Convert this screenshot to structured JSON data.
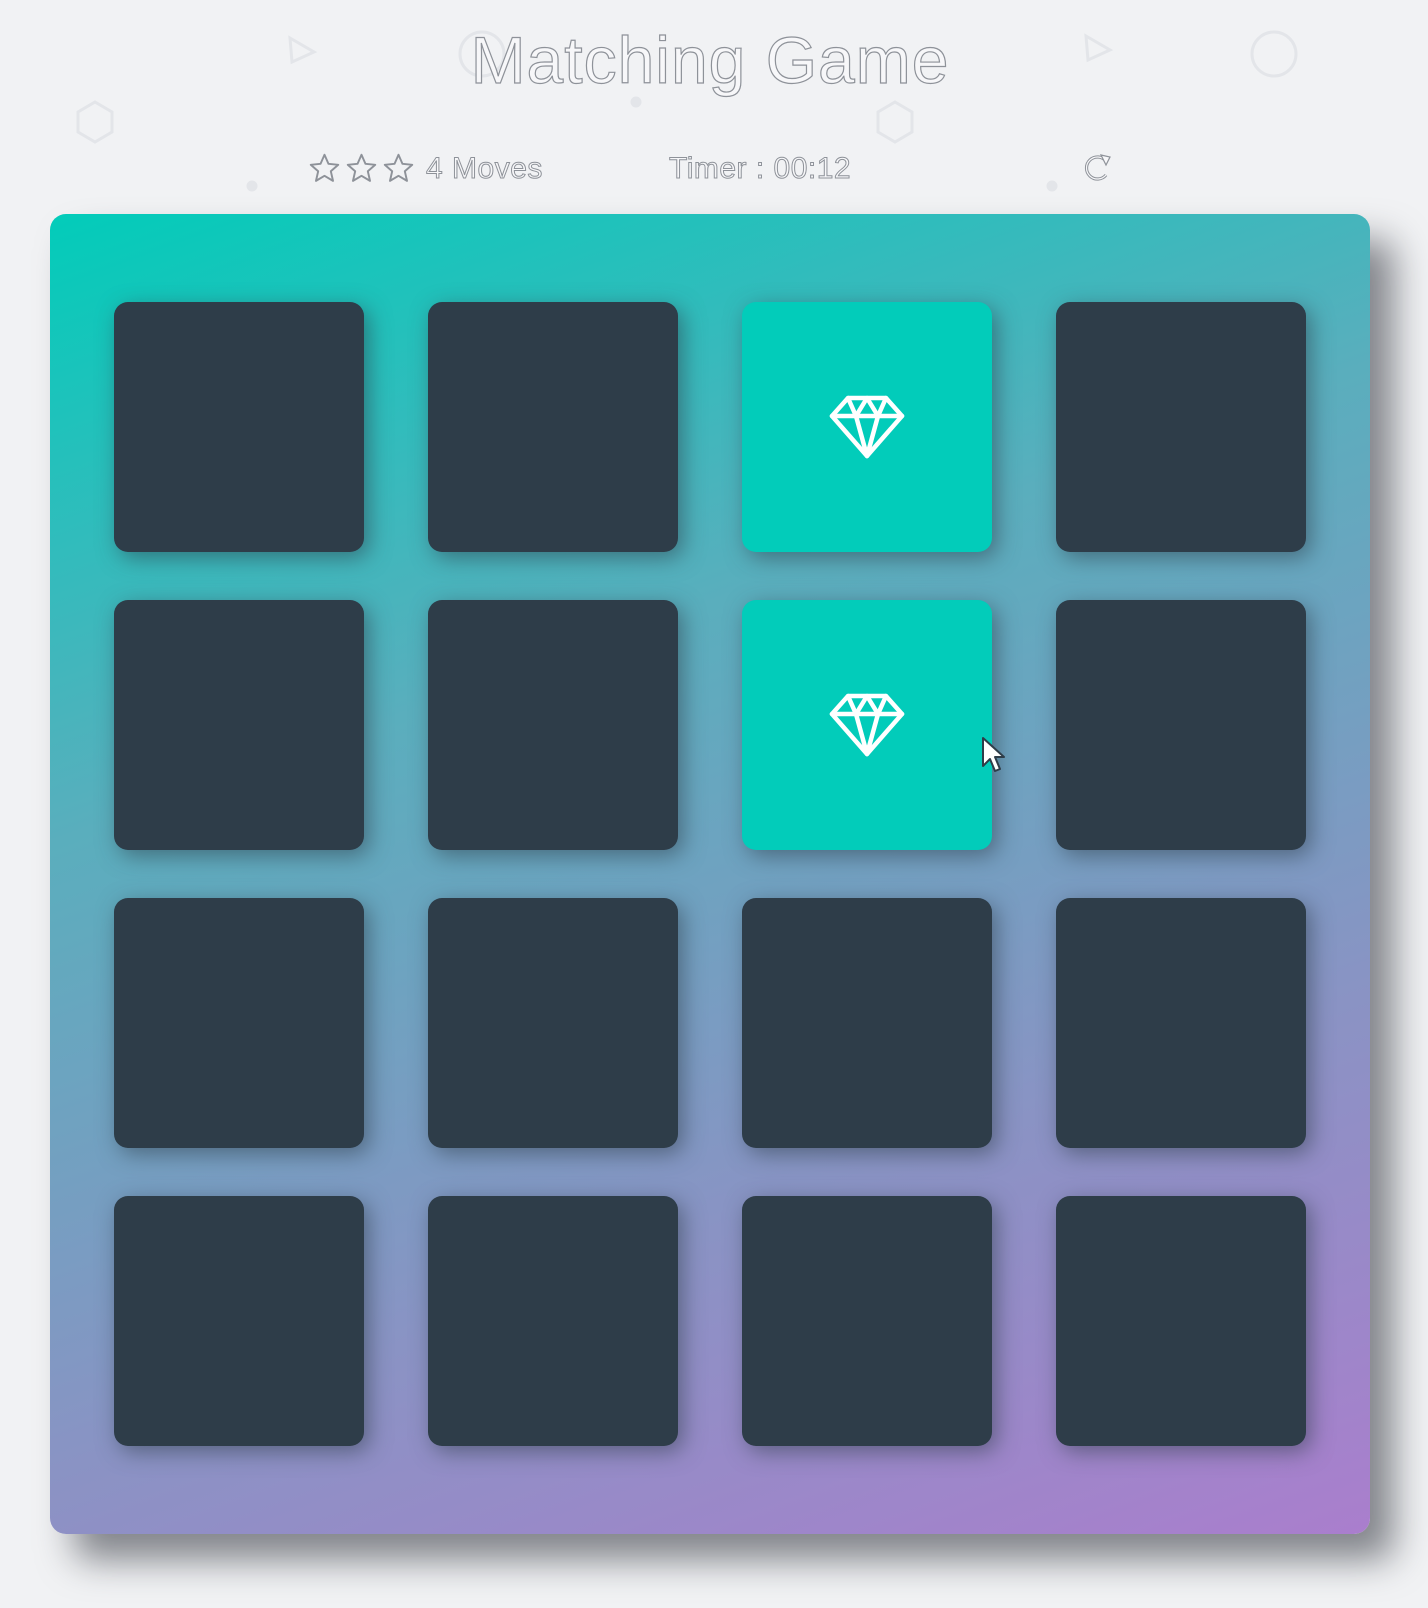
{
  "header": {
    "title": "Matching Game"
  },
  "score_panel": {
    "star_rating": 3,
    "star_total": 3,
    "moves_count": "4",
    "moves_label": "Moves",
    "timer_text": "Timer : 00:12",
    "restart_icon": "restart-icon"
  },
  "deck": {
    "columns": 4,
    "rows": 4,
    "cards": [
      {
        "state": "closed",
        "icon": ""
      },
      {
        "state": "closed",
        "icon": ""
      },
      {
        "state": "open",
        "icon": "diamond-icon"
      },
      {
        "state": "closed",
        "icon": ""
      },
      {
        "state": "closed",
        "icon": ""
      },
      {
        "state": "closed",
        "icon": ""
      },
      {
        "state": "open",
        "icon": "diamond-icon"
      },
      {
        "state": "closed",
        "icon": ""
      },
      {
        "state": "closed",
        "icon": ""
      },
      {
        "state": "closed",
        "icon": ""
      },
      {
        "state": "closed",
        "icon": ""
      },
      {
        "state": "closed",
        "icon": ""
      },
      {
        "state": "closed",
        "icon": ""
      },
      {
        "state": "closed",
        "icon": ""
      },
      {
        "state": "closed",
        "icon": ""
      },
      {
        "state": "closed",
        "icon": ""
      }
    ]
  },
  "colors": {
    "card_closed": "#2e3d49",
    "card_open": "#02ccba",
    "deck_gradient_start": "#02ccba",
    "deck_gradient_end": "#aa7ecd",
    "page_background": "#f1f2f4"
  }
}
